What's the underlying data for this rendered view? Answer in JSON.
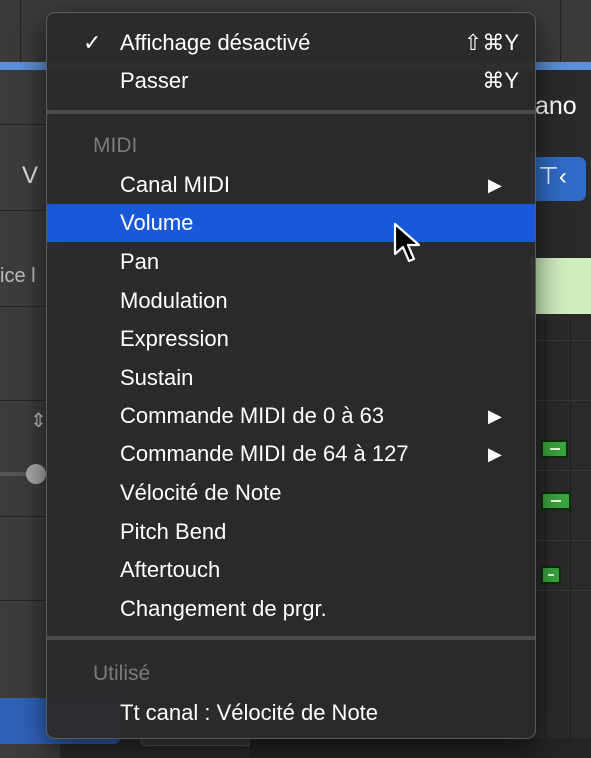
{
  "background": {
    "right_title": "ano",
    "left_letter": "V",
    "left_fragment": "ice l"
  },
  "menu": {
    "items_top": [
      {
        "label": "Affichage désactivé",
        "checked": true,
        "shortcut": "⇧⌘Y"
      },
      {
        "label": "Passer",
        "checked": false,
        "shortcut": "⌘Y"
      }
    ],
    "midi_header": "MIDI",
    "midi_items": [
      {
        "label": "Canal MIDI",
        "submenu": true
      },
      {
        "label": "Volume",
        "highlighted": true
      },
      {
        "label": "Pan"
      },
      {
        "label": "Modulation"
      },
      {
        "label": "Expression"
      },
      {
        "label": "Sustain"
      },
      {
        "label": "Commande MIDI de 0 à 63",
        "submenu": true
      },
      {
        "label": "Commande MIDI de 64 à 127",
        "submenu": true
      },
      {
        "label": "Vélocité de Note"
      },
      {
        "label": "Pitch Bend"
      },
      {
        "label": "Aftertouch"
      },
      {
        "label": "Changement de prgr."
      }
    ],
    "used_header": "Utilisé",
    "used_items": [
      {
        "label": "Tt canal : Vélocité de Note"
      }
    ],
    "check_glyph": "✓",
    "submenu_glyph": "▶"
  },
  "colors": {
    "highlight": "#1859d9",
    "menu_bg": "#2a2a2a"
  }
}
